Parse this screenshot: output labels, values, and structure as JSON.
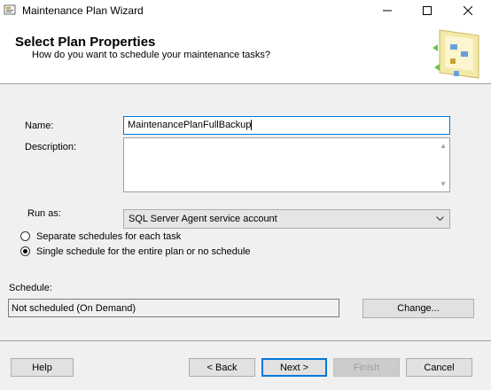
{
  "window": {
    "title": "Maintenance Plan Wizard",
    "controls": [
      "minimize-icon",
      "maximize-icon",
      "close-icon"
    ]
  },
  "header": {
    "title": "Select Plan Properties",
    "subtitle": "How do you want to schedule your maintenance tasks?"
  },
  "form": {
    "name_label": "Name:",
    "name_value": "MaintenancePlanFullBackup",
    "description_label": "Description:",
    "description_value": "",
    "runas_label": "Run as:",
    "runas_value": "SQL Server Agent service account",
    "radio_separate": "Separate schedules for each task",
    "radio_single": "Single schedule for the entire plan or no schedule",
    "selected_radio": "single",
    "schedule_label": "Schedule:",
    "schedule_value": "Not scheduled (On Demand)",
    "change_button": "Change..."
  },
  "buttons": {
    "help": "Help",
    "back": "< Back",
    "next": "Next >",
    "finish": "Finish",
    "cancel": "Cancel"
  },
  "colors": {
    "accent": "#0078d7",
    "window_bg": "#f0f0f0"
  }
}
